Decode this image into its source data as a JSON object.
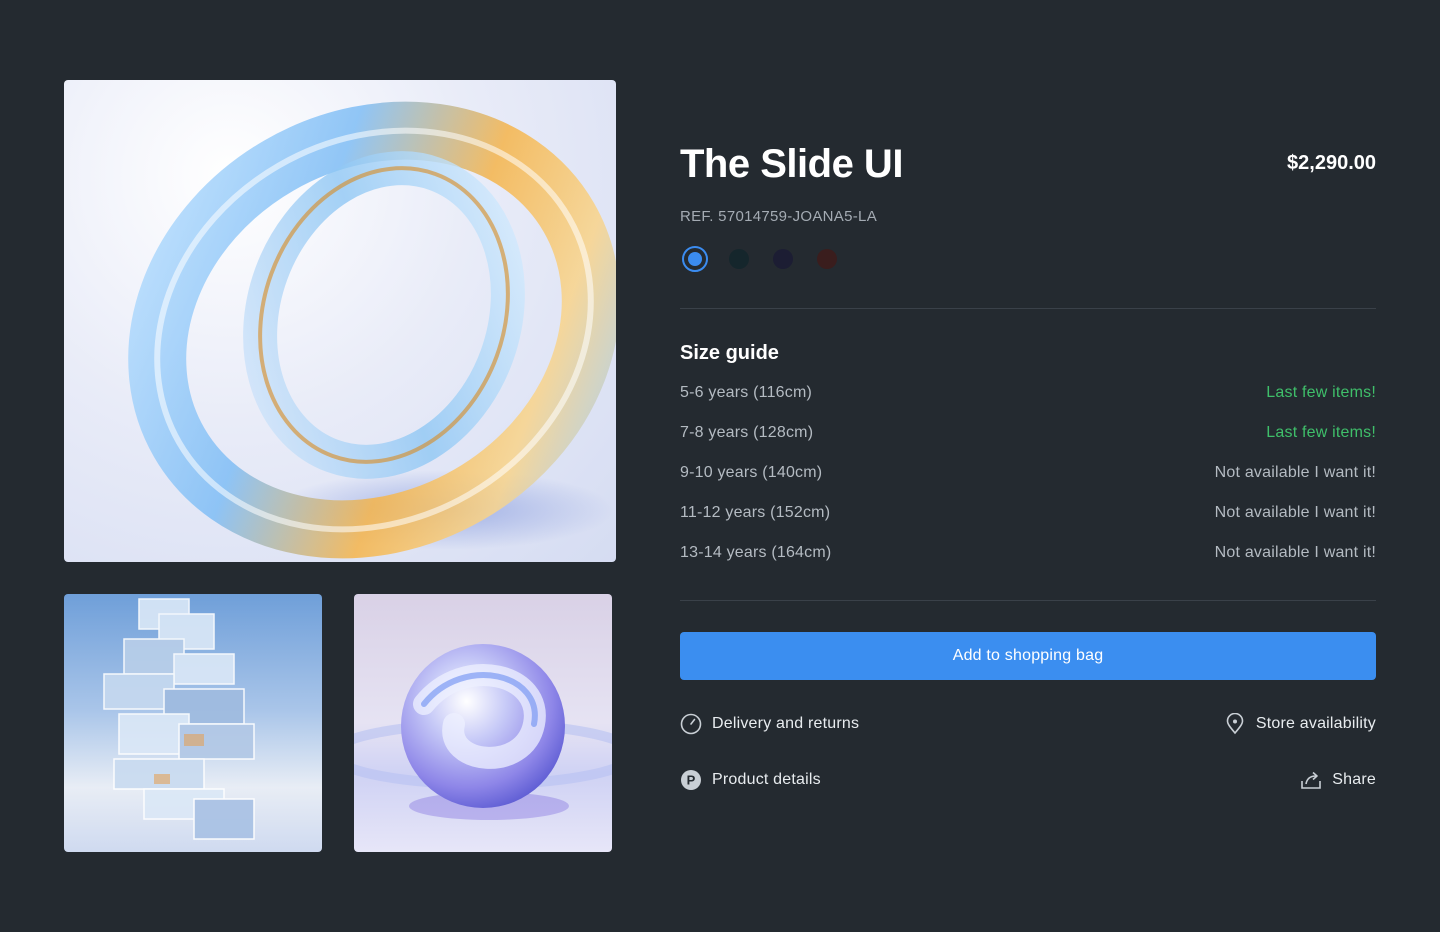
{
  "product": {
    "title": "The Slide UI",
    "price": "$2,290.00",
    "ref": "REF. 57014759-JOANA5-LA"
  },
  "colors": [
    {
      "name": "blue",
      "hex": "#3b8cf0",
      "selected": true
    },
    {
      "name": "dark-teal",
      "hex": "#15262c",
      "selected": false
    },
    {
      "name": "dark-navy",
      "hex": "#1c1d33",
      "selected": false
    },
    {
      "name": "dark-maroon",
      "hex": "#3a1d1d",
      "selected": false
    }
  ],
  "size_guide": {
    "heading": "Size guide",
    "rows": [
      {
        "label": "5-6 years (116cm)",
        "status": "Last few items!",
        "kind": "few"
      },
      {
        "label": "7-8 years (128cm)",
        "status": "Last few items!",
        "kind": "few"
      },
      {
        "label": "9-10 years (140cm)",
        "status": "Not available I want it!",
        "kind": "na"
      },
      {
        "label": "11-12 years (152cm)",
        "status": "Not available I want it!",
        "kind": "na"
      },
      {
        "label": "13-14 years (164cm)",
        "status": "Not available I want it!",
        "kind": "na"
      }
    ]
  },
  "cta": {
    "label": "Add to shopping bag"
  },
  "actions": {
    "delivery": "Delivery and returns",
    "store": "Store availability",
    "details": "Product details",
    "share": "Share"
  },
  "theme": {
    "background": "#242a30",
    "accent": "#3b8ef0",
    "success": "#3fbf6a"
  }
}
